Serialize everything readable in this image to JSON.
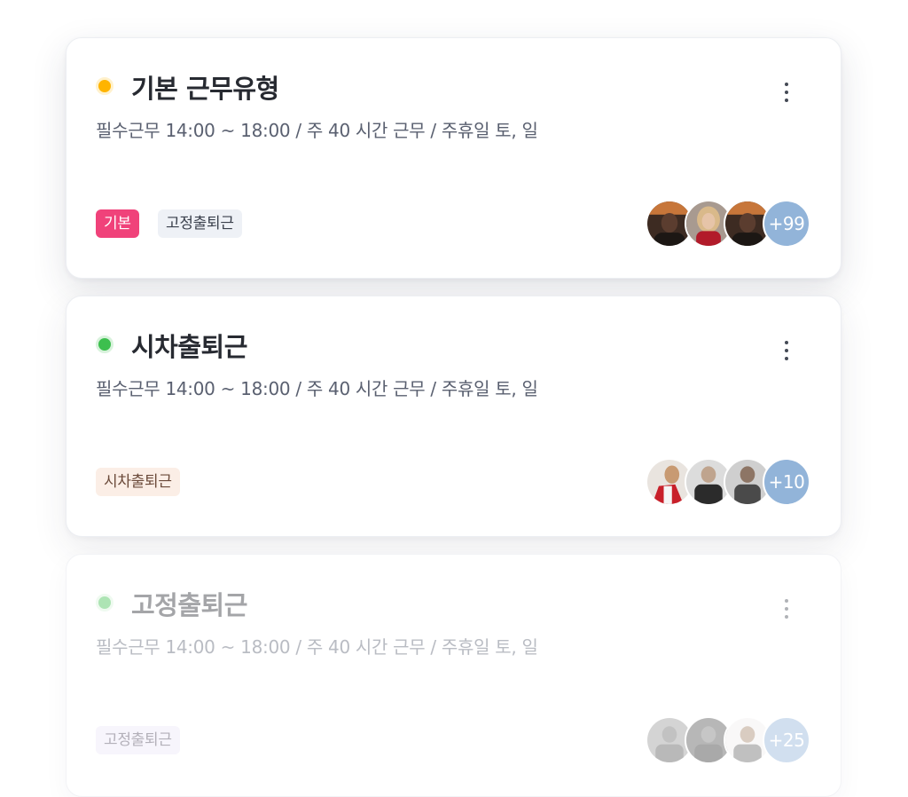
{
  "cards": [
    {
      "title": "기본 근무유형",
      "subtitle": "필수근무 14:00 ~ 18:00 / 주 40 시간 근무 / 주휴일 토, 일",
      "dot_color": "#ffb400",
      "dot_ring_color": "#fff1cc",
      "tags": [
        {
          "label": "기본",
          "bg": "#f0427a",
          "fg": "#ffffff"
        },
        {
          "label": "고정출퇴근",
          "bg": "#eef1f6",
          "fg": "#3a404c"
        }
      ],
      "more_count": "+99",
      "more_color": "#92b4d9"
    },
    {
      "title": "시차출퇴근",
      "subtitle": "필수근무 14:00 ~ 18:00 / 주 40 시간 근무 / 주휴일 토, 일",
      "dot_color": "#3dbf4e",
      "dot_ring_color": "#d8f2dc",
      "tags": [
        {
          "label": "시차출퇴근",
          "bg": "#fbeee6",
          "fg": "#6b4a3a"
        }
      ],
      "more_count": "+10",
      "more_color": "#92b4d9"
    },
    {
      "title": "고정출퇴근",
      "subtitle": "필수근무 14:00 ~ 18:00 / 주 40 시간 근무 / 주휴일 토, 일",
      "dot_color": "#3dbf4e",
      "dot_ring_color": "#d8f2dc",
      "tags": [
        {
          "label": "고정출퇴근",
          "bg": "#ece6f7",
          "fg": "#4a4458"
        }
      ],
      "more_count": "+25",
      "more_color": "#92b4d9"
    }
  ],
  "icons": {
    "menu": "more-vertical-icon"
  }
}
